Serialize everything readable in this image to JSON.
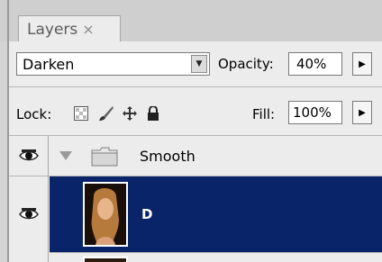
{
  "panel": {
    "tab_label": "Layers",
    "tab_close": "×"
  },
  "blend": {
    "mode": "Darken",
    "opacity_label": "Opacity:",
    "opacity_value": "40%"
  },
  "lock": {
    "label": "Lock:",
    "fill_label": "Fill:",
    "fill_value": "100%"
  },
  "layers": [
    {
      "name": "Smooth",
      "type": "group",
      "visible": true,
      "expanded": true
    },
    {
      "name": "D",
      "type": "layer",
      "visible": true,
      "selected": true
    }
  ],
  "colors": {
    "selection": "#0a246a",
    "panel_bg": "#ececec"
  }
}
